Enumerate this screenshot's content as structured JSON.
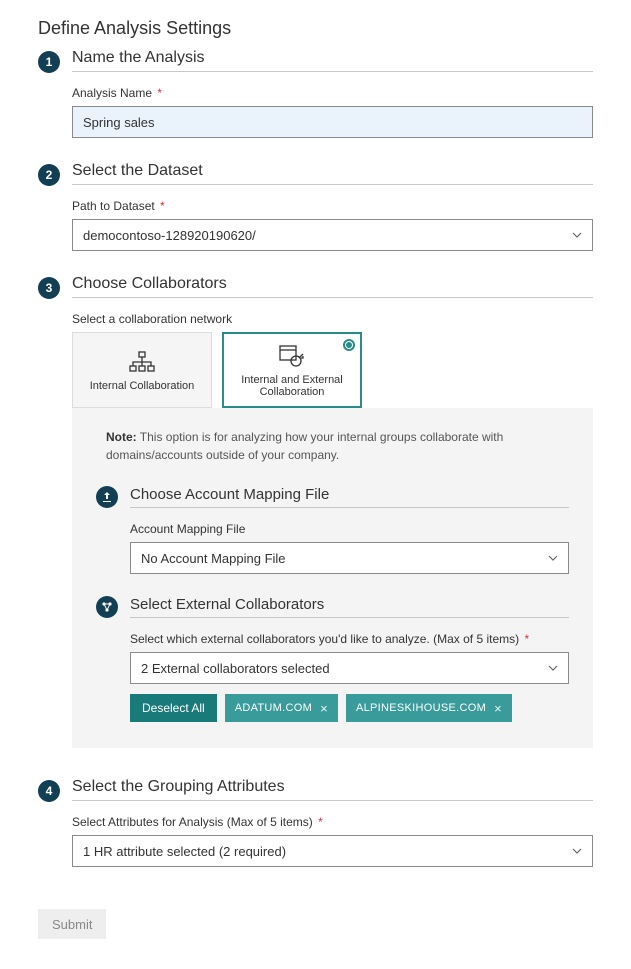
{
  "page_title": "Define Analysis Settings",
  "steps": {
    "s1": {
      "num": "1",
      "heading": "Name the Analysis",
      "field_label": "Analysis Name",
      "value": "Spring sales"
    },
    "s2": {
      "num": "2",
      "heading": "Select the Dataset",
      "field_label": "Path to Dataset",
      "value": "democontoso-128920190620/"
    },
    "s3": {
      "num": "3",
      "heading": "Choose Collaborators",
      "field_label": "Select a collaboration network",
      "card_internal": "Internal Collaboration",
      "card_both": "Internal and External Collaboration",
      "note_bold": "Note:",
      "note_text": " This option is for analyzing how your internal groups collaborate with domains/accounts outside of your company.",
      "mapping": {
        "heading": "Choose Account Mapping File",
        "field_label": "Account Mapping File",
        "value": "No Account Mapping File"
      },
      "external": {
        "heading": "Select External Collaborators",
        "field_label": "Select which external collaborators you'd like to analyze. (Max of 5 items)",
        "value": "2 External collaborators selected",
        "deselect": "Deselect All",
        "chips": [
          "ADATUM.COM",
          "ALPINESKIHOUSE.COM"
        ]
      }
    },
    "s4": {
      "num": "4",
      "heading": "Select the Grouping Attributes",
      "field_label": "Select Attributes for Analysis (Max of 5 items)",
      "value": "1 HR attribute selected (2 required)"
    }
  },
  "submit": "Submit"
}
